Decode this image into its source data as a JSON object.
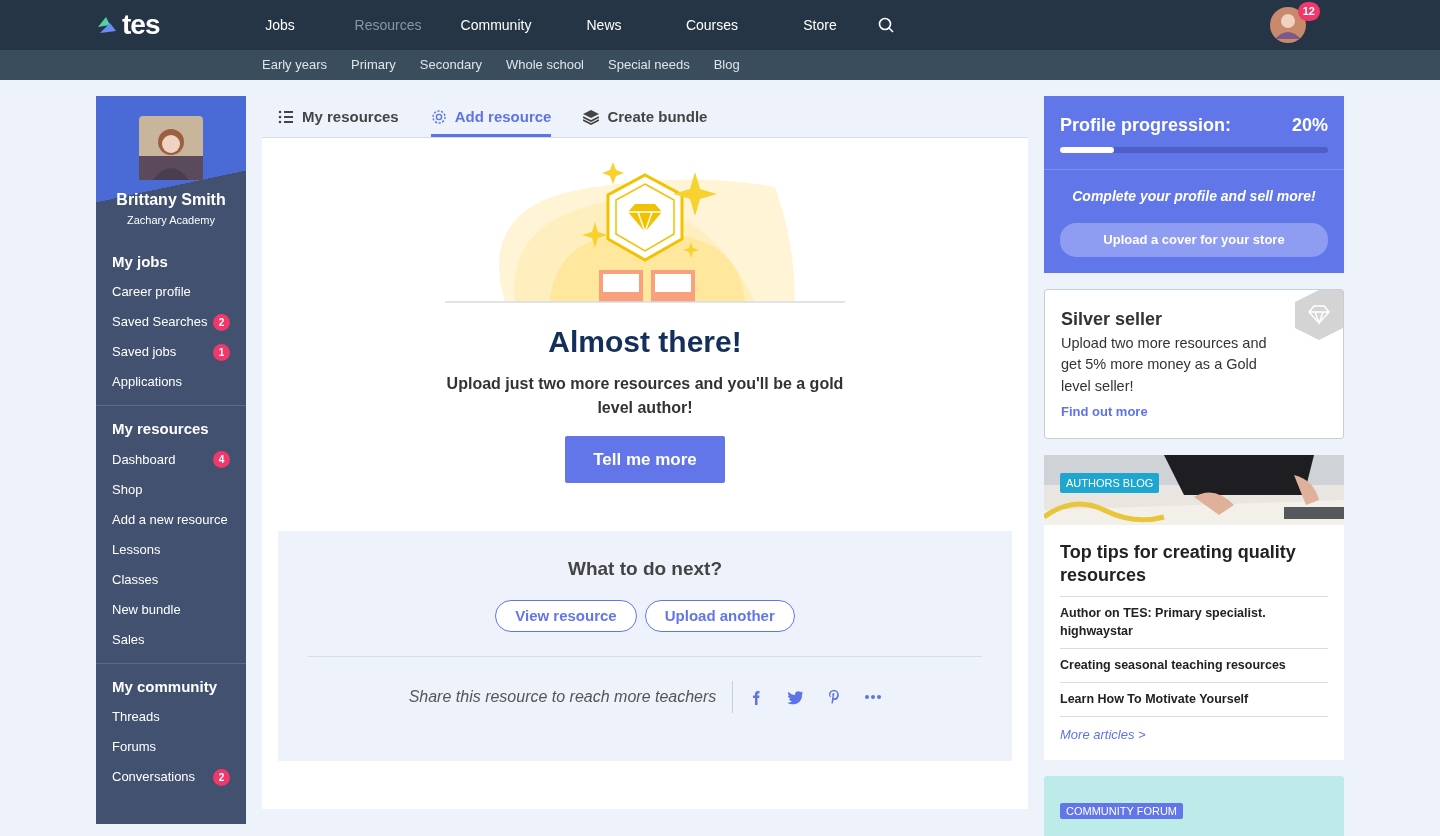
{
  "header": {
    "logo": "tes",
    "nav": [
      {
        "label": "Jobs",
        "selected": false
      },
      {
        "label": "Resources",
        "selected": true
      },
      {
        "label": "Community",
        "selected": false
      },
      {
        "label": "News",
        "selected": false
      },
      {
        "label": "Courses",
        "selected": false
      },
      {
        "label": "Store",
        "selected": false
      }
    ],
    "notification_count": "12"
  },
  "subnav": [
    "Early years",
    "Primary",
    "Secondary",
    "Whole school",
    "Special needs",
    "Blog"
  ],
  "sidebar": {
    "name": "Brittany Smith",
    "school": "Zachary Academy",
    "sections": [
      {
        "title": "My jobs",
        "items": [
          {
            "label": "Career profile"
          },
          {
            "label": "Saved Searches",
            "badge": "2"
          },
          {
            "label": "Saved jobs",
            "badge": "1"
          },
          {
            "label": "Applications"
          }
        ]
      },
      {
        "title": "My resources",
        "items": [
          {
            "label": "Dashboard",
            "badge": "4"
          },
          {
            "label": "Shop"
          },
          {
            "label": "Add a new resource"
          },
          {
            "label": "Lessons"
          },
          {
            "label": "Classes"
          },
          {
            "label": "New bundle"
          },
          {
            "label": "Sales"
          }
        ]
      },
      {
        "title": "My community",
        "items": [
          {
            "label": "Threads"
          },
          {
            "label": "Forums"
          },
          {
            "label": "Conversations",
            "badge": "2"
          }
        ]
      }
    ]
  },
  "tabs": [
    {
      "label": "My resources",
      "selected": false
    },
    {
      "label": "Add resource",
      "selected": true
    },
    {
      "label": "Create bundle",
      "selected": false
    }
  ],
  "hero": {
    "title": "Almost there!",
    "text": "Upload just two more resources and you'll be a gold level author!",
    "button": "Tell me more"
  },
  "next": {
    "title": "What to do next?",
    "buttons": [
      "View resource",
      "Upload another"
    ],
    "share_text": "Share this resource to reach more teachers"
  },
  "profile": {
    "title": "Profile progression:",
    "percent": "20%",
    "level": 0.2,
    "prompt": "Complete your profile and sell more!",
    "button": "Upload a cover for your store"
  },
  "seller": {
    "title": "Silver seller",
    "text": "Upload two more resources and get 5% more money as a Gold level seller!",
    "link": "Find out more"
  },
  "blog": {
    "tag": "AUTHORS BLOG",
    "title": "Top tips for creating quality resources",
    "articles": [
      "Author on TES: Primary specialist. highwaystar",
      "Creating seasonal teaching resources",
      "Learn How To Motivate Yourself"
    ],
    "more": "More articles >"
  },
  "forum": {
    "tag": "COMMUNITY FORUM"
  }
}
